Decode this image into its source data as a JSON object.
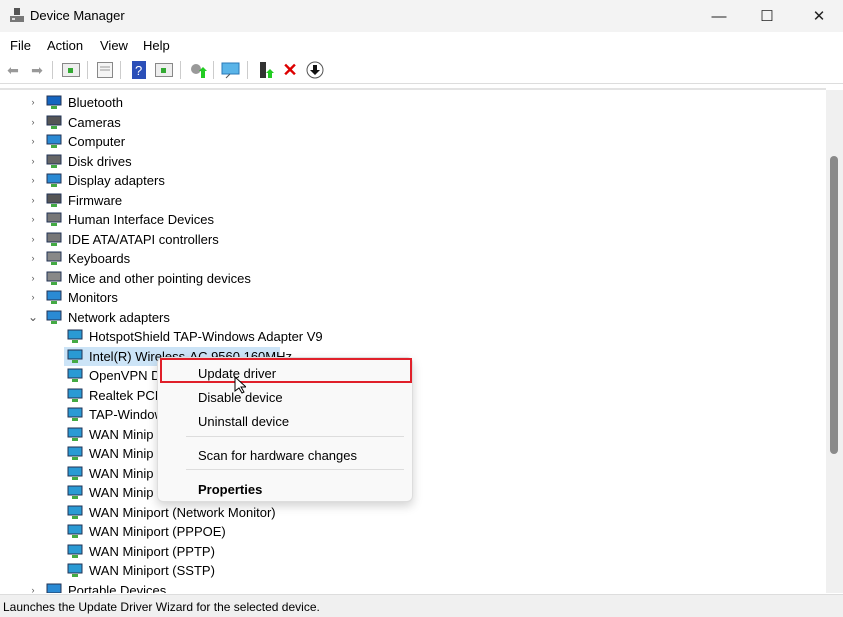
{
  "window": {
    "title": "Device Manager",
    "minimize": "—",
    "maximize": "☐",
    "close": "✕"
  },
  "menu": [
    "File",
    "Action",
    "View",
    "Help"
  ],
  "toolbar": [
    "back-icon",
    "forward-icon",
    "show-hide-console-tree-icon",
    "properties-icon",
    "help-icon",
    "action-pane-icon",
    "update-driver-icon",
    "scan-hardware-icon",
    "enable-device-icon",
    "uninstall-icon",
    "disable-device-icon"
  ],
  "tree": [
    {
      "label": "Bluetooth",
      "level": 0,
      "exp": "›",
      "color": "#1565c0"
    },
    {
      "label": "Cameras",
      "level": 0,
      "exp": "›",
      "color": "#555"
    },
    {
      "label": "Computer",
      "level": 0,
      "exp": "›",
      "color": "#2a8ad4"
    },
    {
      "label": "Disk drives",
      "level": 0,
      "exp": "›",
      "color": "#666"
    },
    {
      "label": "Display adapters",
      "level": 0,
      "exp": "›",
      "color": "#2a8ad4"
    },
    {
      "label": "Firmware",
      "level": 0,
      "exp": "›",
      "color": "#555"
    },
    {
      "label": "Human Interface Devices",
      "level": 0,
      "exp": "›",
      "color": "#777"
    },
    {
      "label": "IDE ATA/ATAPI controllers",
      "level": 0,
      "exp": "›",
      "color": "#777"
    },
    {
      "label": "Keyboards",
      "level": 0,
      "exp": "›",
      "color": "#888"
    },
    {
      "label": "Mice and other pointing devices",
      "level": 0,
      "exp": "›",
      "color": "#888"
    },
    {
      "label": "Monitors",
      "level": 0,
      "exp": "›",
      "color": "#2a8ad4"
    },
    {
      "label": "Network adapters",
      "level": 0,
      "exp": "⌄",
      "color": "#2a8ad4"
    },
    {
      "label": "HotspotShield TAP-Windows Adapter V9",
      "level": 1,
      "color": "#2a9ad4"
    },
    {
      "label": "Intel(R) Wireless-AC 9560 160MHz",
      "level": 1,
      "color": "#2a9ad4",
      "selected": true
    },
    {
      "label": "OpenVPN D",
      "level": 1,
      "color": "#2a9ad4"
    },
    {
      "label": "Realtek PCIe",
      "level": 1,
      "color": "#2a9ad4"
    },
    {
      "label": "TAP-Window",
      "level": 1,
      "color": "#2a9ad4"
    },
    {
      "label": "WAN Minip",
      "level": 1,
      "color": "#2a9ad4"
    },
    {
      "label": "WAN Minip",
      "level": 1,
      "color": "#2a9ad4"
    },
    {
      "label": "WAN Minip",
      "level": 1,
      "color": "#2a9ad4"
    },
    {
      "label": "WAN Minip",
      "level": 1,
      "color": "#2a9ad4"
    },
    {
      "label": "WAN Miniport (Network Monitor)",
      "level": 1,
      "color": "#2a9ad4"
    },
    {
      "label": "WAN Miniport (PPPOE)",
      "level": 1,
      "color": "#2a9ad4"
    },
    {
      "label": "WAN Miniport (PPTP)",
      "level": 1,
      "color": "#2a9ad4"
    },
    {
      "label": "WAN Miniport (SSTP)",
      "level": 1,
      "color": "#2a9ad4"
    },
    {
      "label": "Portable Devices",
      "level": 0,
      "exp": "›",
      "color": "#2a8ad4"
    }
  ],
  "context_menu": {
    "update": "Update driver",
    "disable": "Disable device",
    "uninstall": "Uninstall device",
    "scan": "Scan for hardware changes",
    "properties": "Properties"
  },
  "status": "Launches the Update Driver Wizard for the selected device.",
  "colors": {
    "highlight": "#e0202a",
    "selection": "#cce4f7"
  }
}
